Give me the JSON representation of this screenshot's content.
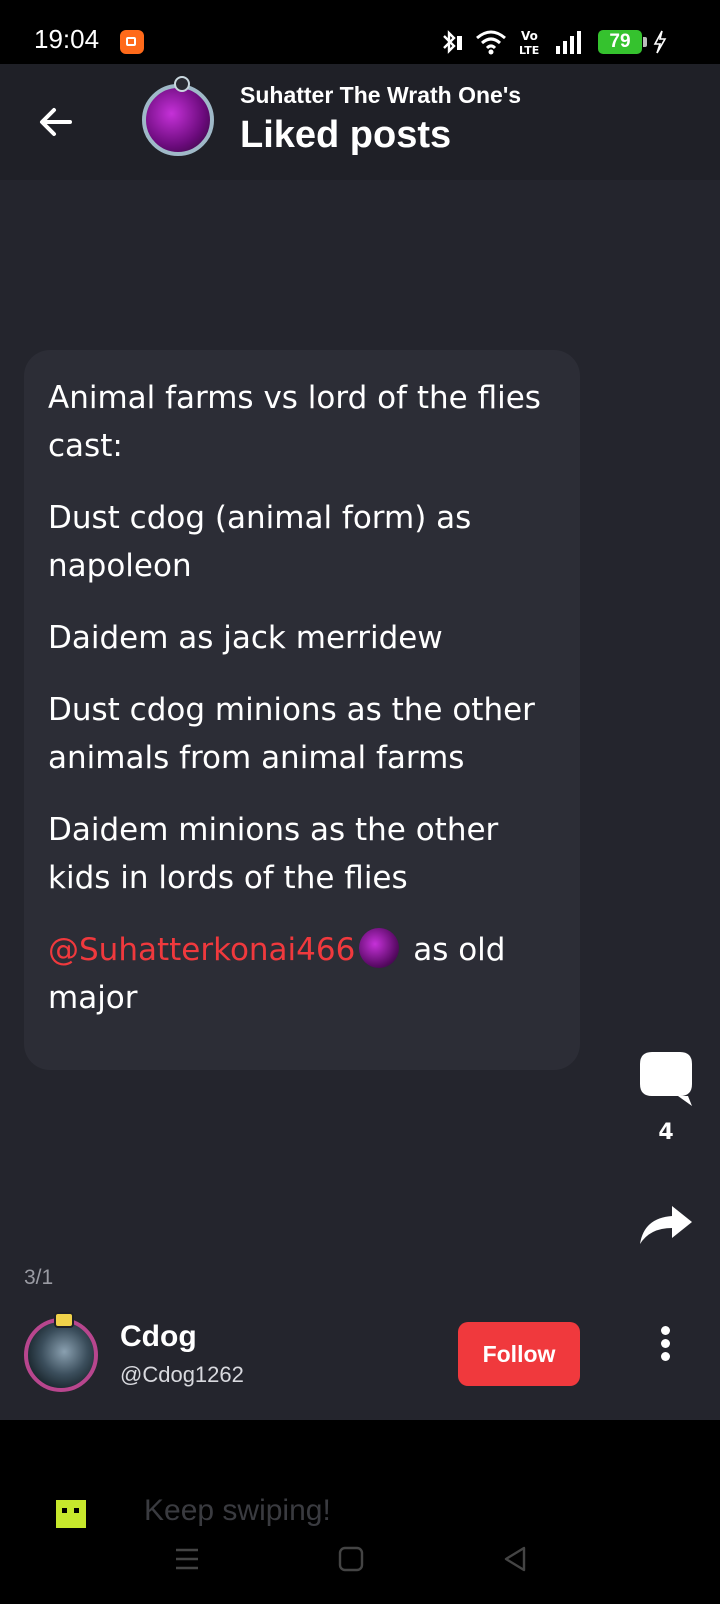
{
  "status_bar": {
    "time": "19:04",
    "battery": "79",
    "icons": [
      "screen-record-icon",
      "bluetooth-icon",
      "wifi-icon",
      "volte-icon",
      "signal-icon",
      "battery-icon",
      "charging-bolt-icon"
    ],
    "volte_top": "Vo",
    "volte_bottom": "LTE"
  },
  "header": {
    "subtitle": "Suhatter The Wrath One's",
    "title": "Liked posts"
  },
  "post": {
    "paragraphs": [
      "Animal farms vs lord of the flies cast:",
      "Dust cdog (animal form) as napoleon",
      "Daidem as jack merridew",
      "Dust cdog minions as the other animals from animal farms",
      "Daidem minions as the other kids in lords of the flies"
    ],
    "mention": "@Suhatterkonai466",
    "mention_suffix": " as old major"
  },
  "actions": {
    "comment_count": "4"
  },
  "pager": "3/1",
  "author": {
    "name": "Cdog",
    "handle": "@Cdog1262",
    "follow_label": "Follow"
  },
  "bottom": {
    "text": "Keep swiping!"
  },
  "colors": {
    "background": "#24252d",
    "card": "#2c2d36",
    "accent_red": "#f0393d",
    "battery_green": "#35c22e"
  }
}
